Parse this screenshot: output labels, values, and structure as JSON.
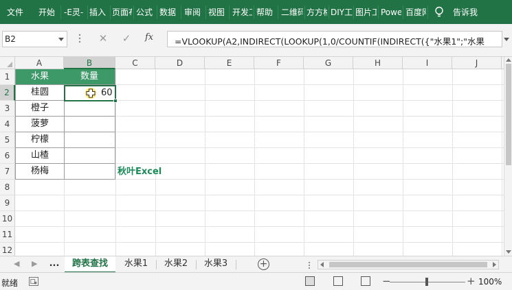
{
  "ribbon": {
    "tabs": [
      "文件",
      "开始",
      "-E灵-",
      "插入",
      "页面布",
      "公式",
      "数据",
      "审阅",
      "视图",
      "开发工",
      "帮助",
      "二维码",
      "方方格",
      "DIY工",
      "图片工",
      "Power",
      "百度网"
    ],
    "tell_me": "告诉我"
  },
  "formula_bar": {
    "name_box": "B2",
    "cancel": "✕",
    "confirm": "✓",
    "fx": "fx",
    "formula": "=VLOOKUP(A2,INDIRECT(LOOKUP(1,0/COUNTIF(INDIRECT({\"水果1\";\"水果"
  },
  "grid": {
    "columns": [
      "A",
      "B",
      "C",
      "D",
      "E",
      "F",
      "G",
      "H",
      "I",
      "J"
    ],
    "rows": [
      "1",
      "2",
      "3",
      "4",
      "5",
      "6",
      "7",
      "8",
      "9",
      "10",
      "11",
      "12"
    ],
    "header_a": "水果",
    "header_b": "数量",
    "fruits": [
      "桂圆",
      "橙子",
      "菠萝",
      "柠檬",
      "山楂",
      "杨梅"
    ],
    "b2_value": "60",
    "watermark": "秋叶Excel"
  },
  "sheets": {
    "ellipsis": "...",
    "tabs": [
      "跨表查找",
      "水果1",
      "水果2",
      "水果3"
    ],
    "add": "+"
  },
  "status": {
    "ready": "就绪",
    "zoom": "100%",
    "minus": "−",
    "plus": "+"
  },
  "colors": {
    "brand": "#217346",
    "header_fill": "#3d9a68",
    "watermark": "#1a8a57"
  }
}
